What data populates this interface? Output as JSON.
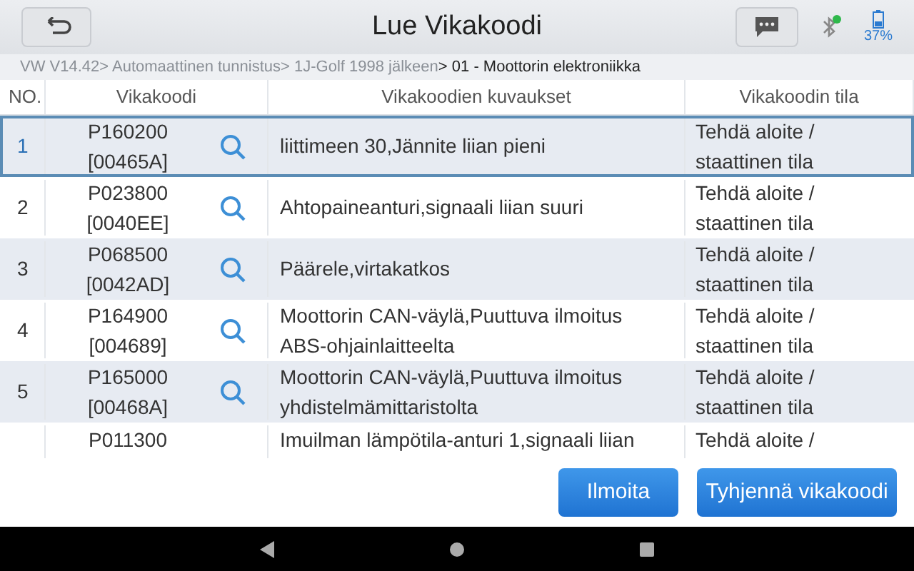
{
  "header": {
    "title": "Lue Vikakoodi",
    "battery_text": "37%"
  },
  "breadcrumb": [
    {
      "label": "VW V14.42> Automaattinen tunnistus> 1J-Golf 1998 jälkeen",
      "current": false
    },
    {
      "label": "> 01 - Moottorin elektroniikka",
      "current": true
    }
  ],
  "table": {
    "columns": [
      "NO.",
      "Vikakoodi",
      "Vikakoodien kuvaukset",
      "Vikakoodin tila"
    ],
    "rows": [
      {
        "no": "1",
        "code": [
          "P160200",
          "[00465A]"
        ],
        "description": [
          "liittimeen 30,Jännite liian pieni"
        ],
        "status": [
          "Tehdä aloite /",
          "staattinen tila"
        ],
        "selected": true
      },
      {
        "no": "2",
        "code": [
          "P023800",
          "[0040EE]"
        ],
        "description": [
          "Ahtopaineanturi,signaali liian suuri"
        ],
        "status": [
          "Tehdä aloite /",
          "staattinen tila"
        ],
        "selected": false
      },
      {
        "no": "3",
        "code": [
          "P068500",
          "[0042AD]"
        ],
        "description": [
          "Päärele,virtakatkos"
        ],
        "status": [
          "Tehdä aloite /",
          "staattinen tila"
        ],
        "selected": false
      },
      {
        "no": "4",
        "code": [
          "P164900",
          "[004689]"
        ],
        "description": [
          "Moottorin CAN-väylä,Puuttuva ilmoitus",
          "ABS-ohjainlaitteelta"
        ],
        "status": [
          "Tehdä aloite /",
          "staattinen tila"
        ],
        "selected": false
      },
      {
        "no": "5",
        "code": [
          "P165000",
          "[00468A]"
        ],
        "description": [
          "Moottorin CAN-väylä,Puuttuva ilmoitus",
          "yhdistelmämittaristolta"
        ],
        "status": [
          "Tehdä aloite /",
          "staattinen tila"
        ],
        "selected": false
      },
      {
        "code": [
          "P011300"
        ],
        "description": [
          "Imuilman lämpötila-anturi 1,signaali liian"
        ],
        "status": [
          "Tehdä aloite /"
        ],
        "selected": false
      }
    ]
  },
  "buttons": [
    "Ilmoita",
    "Tyhjennä vikakoodi"
  ]
}
